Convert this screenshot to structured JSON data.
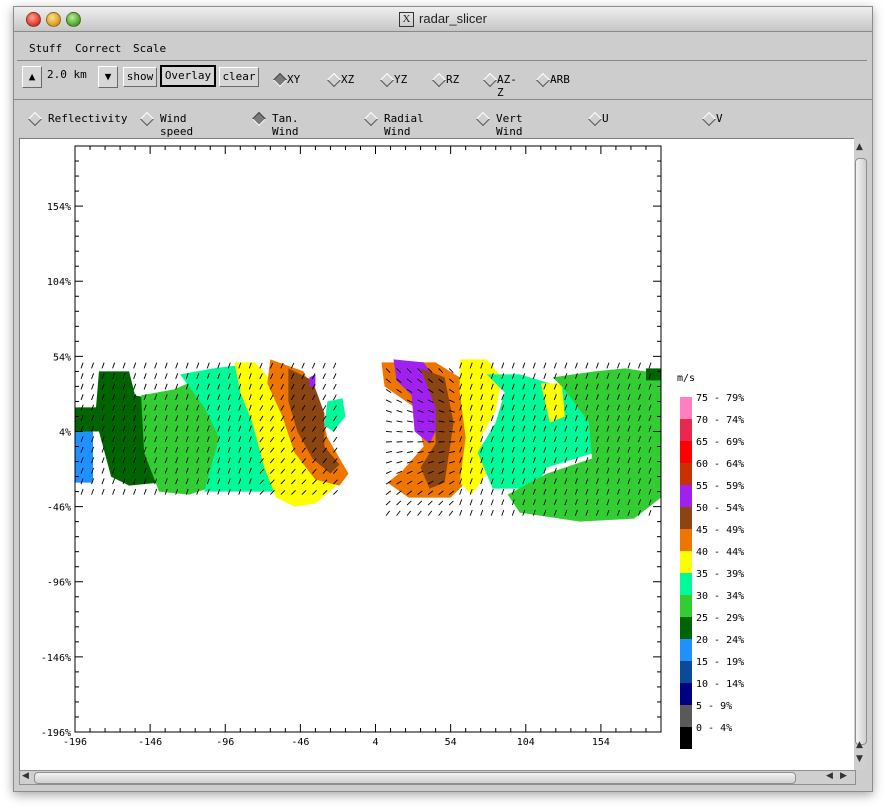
{
  "window": {
    "title": "radar_slicer"
  },
  "menu": [
    "Stuff",
    "Correct",
    "Scale"
  ],
  "toolbar": {
    "up_icon": "▲",
    "down_icon": "▼",
    "height_value": "2.0 km",
    "show": "show",
    "overlay": "Overlay",
    "clear": "clear",
    "views": [
      {
        "label": "XY",
        "selected": true
      },
      {
        "label": "XZ",
        "selected": false
      },
      {
        "label": "YZ",
        "selected": false
      },
      {
        "label": "RZ",
        "selected": false
      },
      {
        "label": "AZ-Z",
        "selected": false
      },
      {
        "label": "ARB",
        "selected": false
      }
    ]
  },
  "fields": [
    {
      "label": "Reflectivity",
      "selected": false
    },
    {
      "label": "Wind speed",
      "selected": false
    },
    {
      "label": "Tan. Wind",
      "selected": true
    },
    {
      "label": "Radial Wind",
      "selected": false
    },
    {
      "label": "Vert Wind",
      "selected": false
    },
    {
      "label": "U",
      "selected": false
    },
    {
      "label": "V",
      "selected": false
    }
  ],
  "plot": {
    "x_ticks": [
      "-196",
      "-146",
      "-96",
      "-46",
      "4",
      "54",
      "104",
      "154"
    ],
    "y_ticks": [
      "154",
      "104",
      "54",
      "4",
      "-46",
      "-96",
      "-146",
      "-196"
    ],
    "tick_suffix": "%"
  },
  "legend": {
    "unit": "m/s",
    "items": [
      {
        "label": "75 - 79%",
        "color": "#ff7fbf"
      },
      {
        "label": "70 - 74%",
        "color": "#e8284d"
      },
      {
        "label": "65 - 69%",
        "color": "#ff0000"
      },
      {
        "label": "60 - 64%",
        "color": "#c83200"
      },
      {
        "label": "55 - 59%",
        "color": "#a020f0"
      },
      {
        "label": "50 - 54%",
        "color": "#8b4513"
      },
      {
        "label": "45 - 49%",
        "color": "#ee7600"
      },
      {
        "label": "40 - 44%",
        "color": "#ffff00"
      },
      {
        "label": "35 - 39%",
        "color": "#00fa9a"
      },
      {
        "label": "30 - 34%",
        "color": "#32cd32"
      },
      {
        "label": "25 - 29%",
        "color": "#006400"
      },
      {
        "label": "20 - 24%",
        "color": "#1e90ff"
      },
      {
        "label": "15 - 19%",
        "color": "#0a4a96"
      },
      {
        "label": "10 - 14%",
        "color": "#000080"
      },
      {
        "label": "5 - 9%",
        "color": "#595959"
      },
      {
        "label": "0 - 4%",
        "color": "#000000"
      }
    ]
  }
}
